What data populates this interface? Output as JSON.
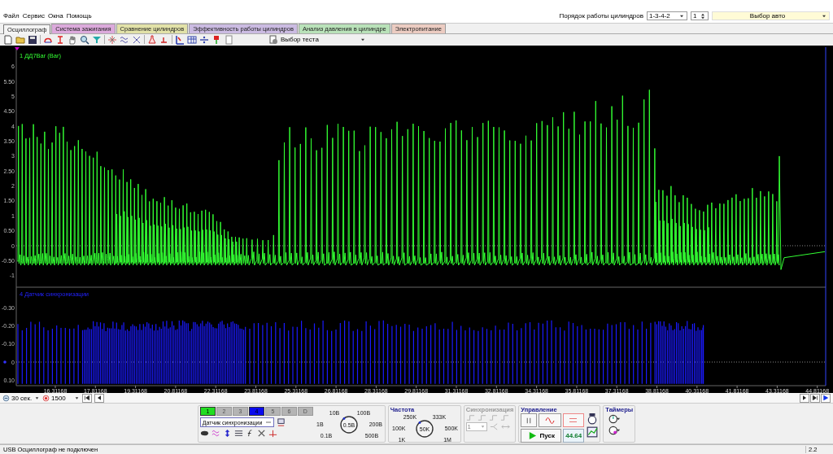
{
  "menu": [
    "Файл",
    "Сервис",
    "Окна",
    "Помощь"
  ],
  "cylinder_order": {
    "label": "Порядок работы цилиндров",
    "value": "1-3-4-2",
    "spin_value": "1"
  },
  "car_select": {
    "value": "Выбор авто"
  },
  "tabs": [
    {
      "label": "Осциллограф",
      "selected": true,
      "color": "#f4f4f4"
    },
    {
      "label": "Система зажигания",
      "selected": false,
      "color": "#dcaadc"
    },
    {
      "label": "Сравнение цилиндров",
      "selected": false,
      "color": "#e2e2a8"
    },
    {
      "label": "Эффективность работы цилиндров",
      "selected": false,
      "color": "#cbbbe2"
    },
    {
      "label": "Анализ давления в цилиндре",
      "selected": false,
      "color": "#b9e2b9"
    },
    {
      "label": "Электропитание",
      "selected": false,
      "color": "#ecccc2"
    }
  ],
  "test_select": {
    "label": "Выбор теста"
  },
  "plot": {
    "channel_1": {
      "label": "1 ДД7Bar (Bar)",
      "yticks": [
        "6",
        "5.50",
        "5",
        "4.50",
        "4",
        "3.50",
        "3",
        "2.50",
        "2",
        "1.50",
        "1",
        "0.50",
        "0",
        "-0.50",
        "-1"
      ]
    },
    "channel_4": {
      "label": "4 Датчик синхронизации",
      "yticks": [
        "-0.30",
        "-0.20",
        "-0.10",
        "0",
        "0.10"
      ]
    },
    "time_ticks": [
      "16.31168",
      "17.81168",
      "19.31168",
      "20.81168",
      "22.31168",
      "23.81168",
      "25.31168",
      "26.81168",
      "28.31168",
      "29.81168",
      "31.31168",
      "32.81168",
      "34.31168",
      "35.81168",
      "37.31168",
      "38.81168",
      "40.31168",
      "41.81168",
      "43.31168",
      "44.81168"
    ]
  },
  "time_window": {
    "value": "30 сек."
  },
  "points": {
    "value": "1500"
  },
  "control_panel": {
    "channels": [
      {
        "label": "1",
        "active": true,
        "color": "#22dd22"
      },
      {
        "label": "2",
        "active": false,
        "color": "#b4b4b4"
      },
      {
        "label": "3",
        "active": false,
        "color": "#b4b4b4"
      },
      {
        "label": "4",
        "active": true,
        "color": "#0a0aee"
      },
      {
        "label": "5",
        "active": false,
        "color": "#b4b4b4"
      },
      {
        "label": "6",
        "active": false,
        "color": "#b4b4b4"
      },
      {
        "label": "D",
        "active": false,
        "color": "#b4b4b4"
      }
    ],
    "sensor": "Датчик синхронизации",
    "voltage_knob": {
      "labels": [
        "0.1В",
        "1В",
        "10В",
        "100В",
        "200В",
        "500В"
      ],
      "value": "0.5В"
    },
    "frequency": {
      "title": "Частота",
      "labels": [
        "1K",
        "100K",
        "250K",
        "333K",
        "500K",
        "1M"
      ],
      "value": "50K"
    },
    "sync": {
      "title": "Синхронизация",
      "disabled": true,
      "channel": "1"
    },
    "control": {
      "title": "Управление",
      "start": "Пуск",
      "counter": "44.64"
    },
    "timers": {
      "title": "Таймеры"
    }
  },
  "status": {
    "text": "USB Осциллограф не подключен",
    "version": "2.2"
  }
}
